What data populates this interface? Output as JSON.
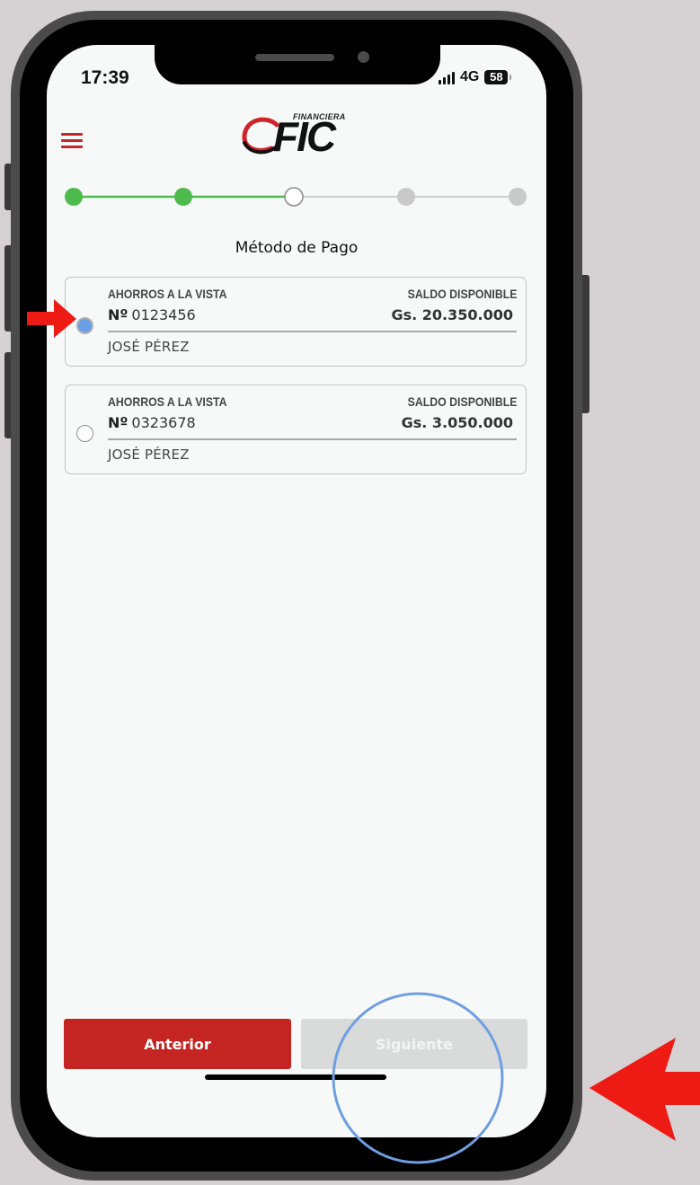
{
  "status_bar": {
    "time": "17:39",
    "network": "4G",
    "battery": "58"
  },
  "header": {
    "logo_small": "FINANCIERA",
    "logo_main": "FIC"
  },
  "stepper": {
    "total_steps": 5,
    "completed_steps": 2,
    "current_step": 3,
    "colors": {
      "done": "#4fba4c",
      "pending": "#c9c9c9",
      "line_pending": "#d0d0d0"
    }
  },
  "page": {
    "title": "Método de Pago"
  },
  "accounts": [
    {
      "type": "AHORROS A LA VISTA",
      "number_prefix": "Nº",
      "number": "0123456",
      "balance_label": "SALDO DISPONIBLE",
      "balance": "Gs. 20.350.000",
      "holder": "JOSÉ PÉREZ",
      "selected": true
    },
    {
      "type": "AHORROS A LA VISTA",
      "number_prefix": "Nº",
      "number": "0323678",
      "balance_label": "SALDO DISPONIBLE",
      "balance": "Gs. 3.050.000",
      "holder": "JOSÉ PÉREZ",
      "selected": false
    }
  ],
  "footer": {
    "prev_label": "Anterior",
    "next_label": "Siguiente"
  },
  "annotation_colors": {
    "arrow": "#ee1b14",
    "circle": "#6f9ee2"
  }
}
